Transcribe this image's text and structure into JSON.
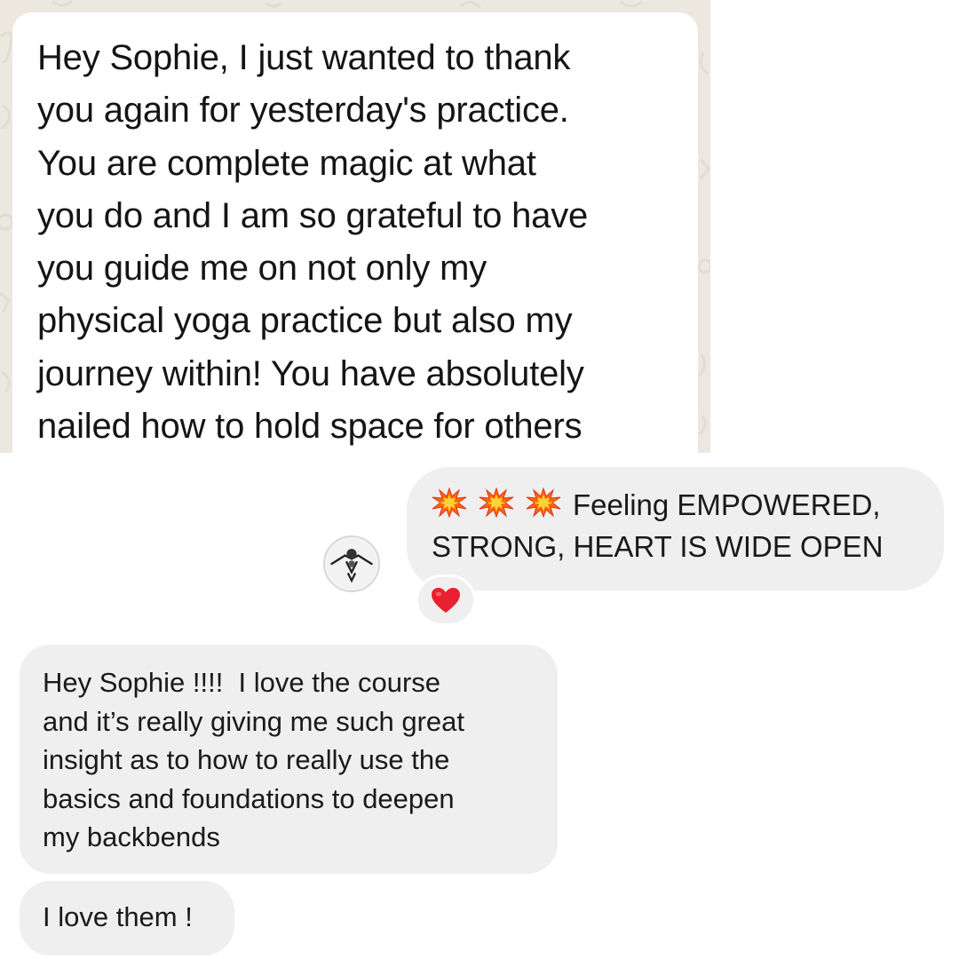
{
  "top_message": {
    "lines": [
      "Hey Sophie, I just wanted to thank",
      "you again for yesterday's practice.",
      "You are complete magic at what",
      "you do and I am so grateful to have",
      "you guide me on not only my",
      "physical yoga practice but also my",
      "journey within! You have absolutely",
      "nailed how to hold space for others"
    ]
  },
  "empowered_message": {
    "emoji_icon": "collision-emoji",
    "emoji_count": 3,
    "line1": "Feeling EMPOWERED,",
    "line2": "STRONG, HEART IS WIDE OPEN",
    "reaction_icon": "red-heart-emoji"
  },
  "avatar": {
    "icon": "yoga-pose-avatar"
  },
  "course_message": {
    "lines": [
      "Hey Sophie !!!!  I love the course",
      "and it’s really giving me such great",
      "insight as to how to really use the",
      "basics and foundations to deepen",
      "my backbends"
    ]
  },
  "short_message": {
    "text": "I love them !"
  },
  "colors": {
    "wallpaper": "#ece8df",
    "bubble_white": "#ffffff",
    "bubble_grey": "#efefef",
    "text": "#1a1a1a",
    "heart": "#e8202f",
    "collision": "#ff6a00"
  }
}
